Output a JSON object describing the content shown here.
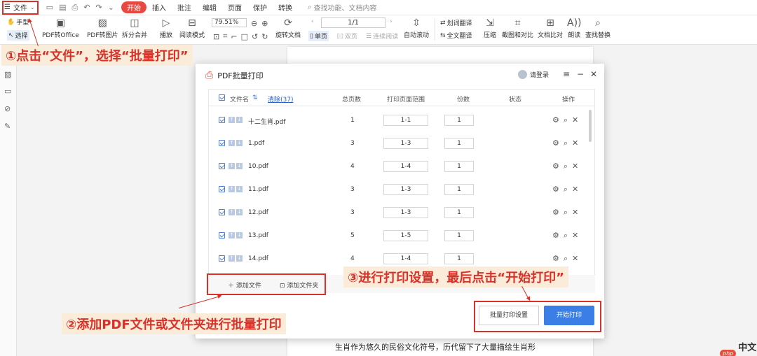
{
  "menubar": {
    "file": "文件",
    "items": [
      {
        "label": "开始"
      },
      {
        "label": "插入"
      },
      {
        "label": "批注"
      },
      {
        "label": "编辑"
      },
      {
        "label": "页面"
      },
      {
        "label": "保护"
      },
      {
        "label": "转换"
      }
    ],
    "search": "查找功能、文档内容"
  },
  "toolbar": {
    "hand": "手型",
    "select": "选择",
    "pdf_to_office": "PDF转Office",
    "pdf_to_image": "PDF转图片",
    "split_merge": "拆分合并",
    "play": "播放",
    "read_mode": "阅读模式",
    "zoom": "79.51%",
    "rotate_doc": "旋转文档",
    "page_indicator": "1/1",
    "single_page": "单页",
    "double_page": "双页",
    "continuous": "连续阅读",
    "auto_scroll": "自动滚动",
    "word_translate": "划词翻译",
    "full_translate": "全文翻译",
    "compress": "压缩",
    "screenshot_compare": "截图和对比",
    "doc_compare": "文档比对",
    "read_aloud": "朗读",
    "find_replace": "查找替换"
  },
  "dialog": {
    "title": "PDF批量打印",
    "login": "请登录",
    "table": {
      "headers": {
        "filename": "文件名",
        "clear": "清除(37)",
        "total_pages": "总页数",
        "print_range": "打印页面范围",
        "copies": "份数",
        "status": "状态",
        "actions": "操作"
      },
      "rows": [
        {
          "name": "十二生肖.pdf",
          "pages": "1",
          "range": "1-1",
          "copies": "1"
        },
        {
          "name": "1.pdf",
          "pages": "3",
          "range": "1-3",
          "copies": "1"
        },
        {
          "name": "10.pdf",
          "pages": "4",
          "range": "1-4",
          "copies": "1"
        },
        {
          "name": "11.pdf",
          "pages": "3",
          "range": "1-3",
          "copies": "1"
        },
        {
          "name": "12.pdf",
          "pages": "3",
          "range": "1-3",
          "copies": "1"
        },
        {
          "name": "13.pdf",
          "pages": "5",
          "range": "1-5",
          "copies": "1"
        },
        {
          "name": "14.pdf",
          "pages": "4",
          "range": "1-4",
          "copies": "1"
        }
      ]
    },
    "add_file": "添加文件",
    "add_folder": "添加文件夹",
    "batch_settings": "批量打印设置",
    "start_print": "开始打印"
  },
  "document": {
    "body_text": "生肖作为悠久的民俗文化符号，历代留下了大量描绘生肖形"
  },
  "annotations": {
    "step1": "①点击“文件”，选择“批量打印”",
    "step2": "②添加PDF文件或文件夹进行批量打印",
    "step3": "③进行打印设置，最后点击“开始打印”",
    "color": "#d8312a"
  },
  "watermark": {
    "logo": "php",
    "text": "中文网"
  }
}
